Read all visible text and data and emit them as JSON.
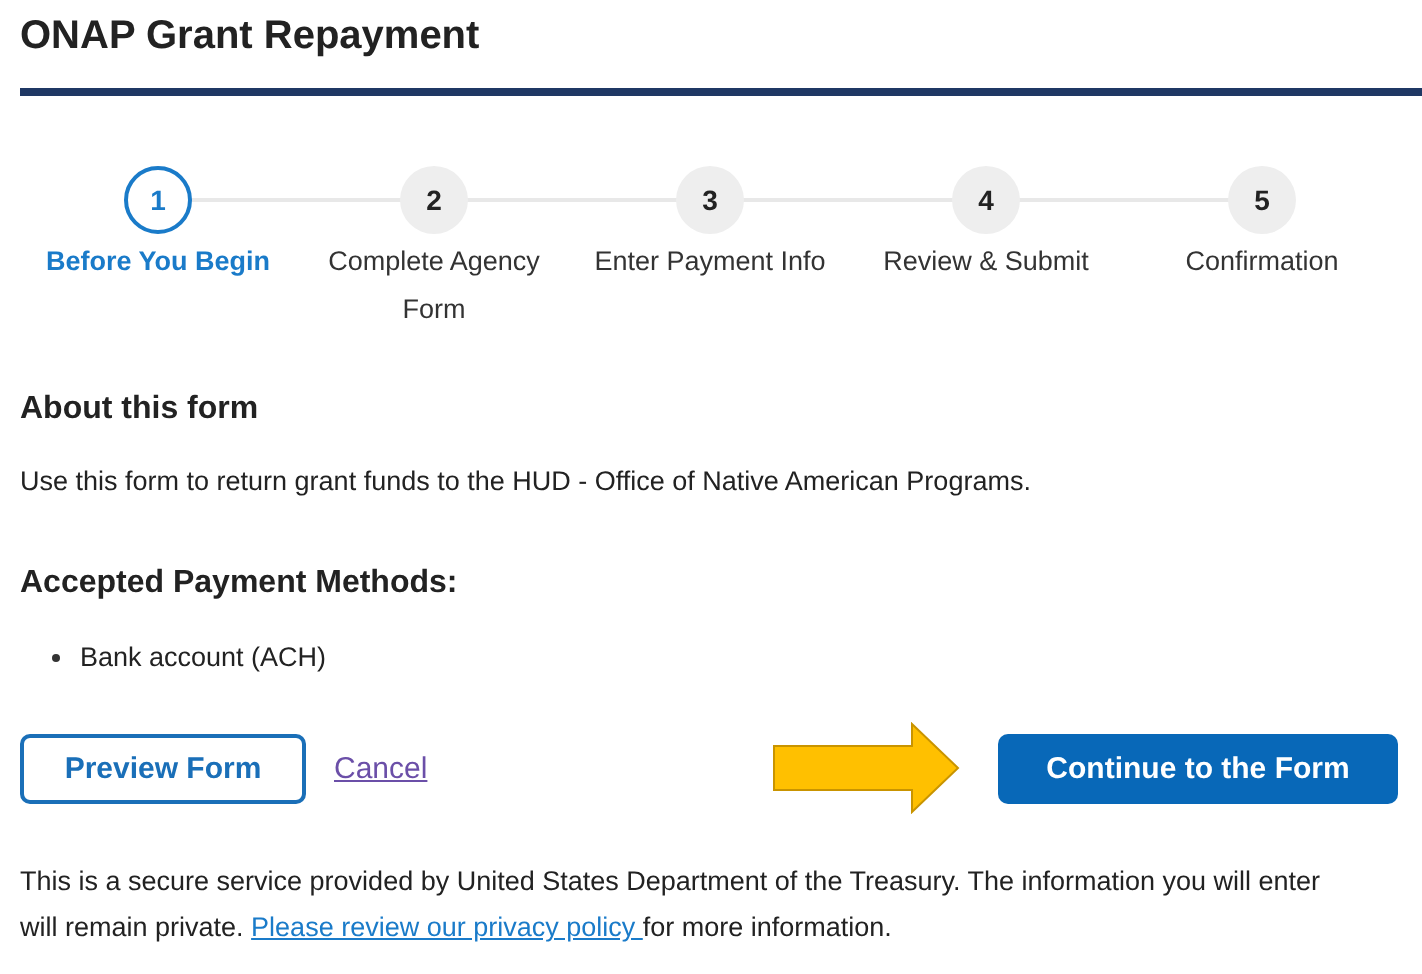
{
  "title": "ONAP Grant Repayment",
  "steps": [
    {
      "number": "1",
      "label": "Before You Begin",
      "selected": true
    },
    {
      "number": "2",
      "label": "Complete Agency Form",
      "selected": false
    },
    {
      "number": "3",
      "label": "Enter Payment Info",
      "selected": false
    },
    {
      "number": "4",
      "label": "Review & Submit",
      "selected": false
    },
    {
      "number": "5",
      "label": "Confirmation",
      "selected": false
    }
  ],
  "about": {
    "heading": "About this form",
    "text": "Use this form to return grant funds to the HUD - Office of Native American Programs."
  },
  "payment_methods": {
    "heading": "Accepted Payment Methods:",
    "items": [
      "Bank account (ACH)"
    ]
  },
  "buttons": {
    "preview": "Preview Form",
    "cancel": "Cancel",
    "continue": "Continue to the Form"
  },
  "footer": {
    "before": "This is a secure service provided by United States Department of the Treasury. The information you will enter will remain private. ",
    "link": "Please review our privacy policy ",
    "after": "for more information."
  }
}
